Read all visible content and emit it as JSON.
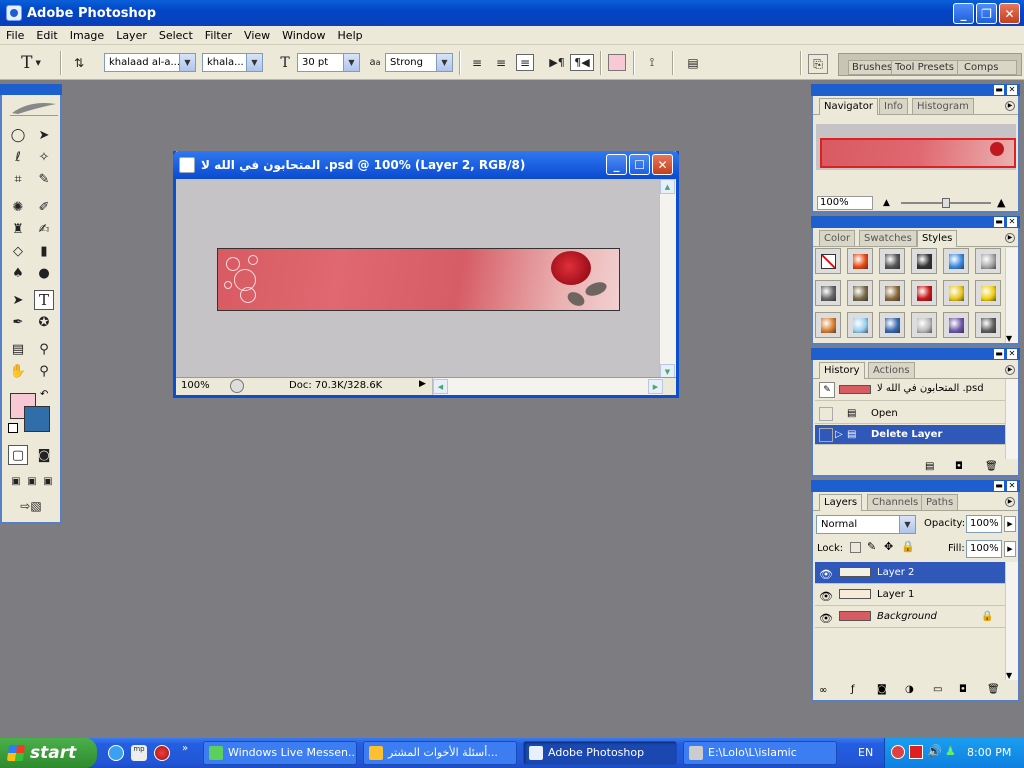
{
  "app": {
    "title": "Adobe Photoshop"
  },
  "menu": [
    "File",
    "Edit",
    "Image",
    "Layer",
    "Select",
    "Filter",
    "View",
    "Window",
    "Help"
  ],
  "options": {
    "font_family": "khalaad al-a...",
    "font_style": "khala...",
    "font_size": "30 pt",
    "aa_label": "a",
    "antialias": "Strong",
    "text_color": "#f8c8d4"
  },
  "palette_well": {
    "tabs": [
      "Brushes",
      "Tool Presets",
      "Comps"
    ]
  },
  "document": {
    "title": "المتحابون في الله لا .psd @ 100% (Layer 2, RGB/8)",
    "zoom": "100%",
    "doc_info": "Doc: 70.3K/328.6K"
  },
  "colors": {
    "foreground": "#f8c8d4",
    "background": "#2f6ea8",
    "selection": "#2f58b8"
  },
  "navigator": {
    "tabs": [
      "Navigator",
      "Info",
      "Histogram"
    ],
    "zoom": "100%",
    "zoom_percent": 50
  },
  "color_panel": {
    "tabs": [
      "Color",
      "Swatches",
      "Styles"
    ]
  },
  "styles": [
    {
      "icon": "none-style",
      "color": "#ffffff"
    },
    {
      "icon": "fire-style",
      "color": "#e84a10"
    },
    {
      "icon": "dark-style",
      "color": "#555555"
    },
    {
      "icon": "chrome-style",
      "color": "#333333"
    },
    {
      "icon": "blue-glass-style",
      "color": "#3a8ae0"
    },
    {
      "icon": "gray-style",
      "color": "#a8a8a8"
    },
    {
      "icon": "steel-style",
      "color": "#666666"
    },
    {
      "icon": "bronze-style",
      "color": "#7a6a48"
    },
    {
      "icon": "wood-style",
      "color": "#8a6a3a"
    },
    {
      "icon": "red-style",
      "color": "#c81818"
    },
    {
      "icon": "multicolor-style",
      "color": "#e8c820"
    },
    {
      "icon": "yellow-style",
      "color": "#f0d010"
    },
    {
      "icon": "orange-style",
      "color": "#d88030"
    },
    {
      "icon": "sky-style",
      "color": "#9ad0f0"
    },
    {
      "icon": "sunset-style",
      "color": "#3a6ab0"
    },
    {
      "icon": "gray-pattern-style",
      "color": "#bcbcbc"
    },
    {
      "icon": "purple-style",
      "color": "#7058a8"
    },
    {
      "icon": "charcoal-style",
      "color": "#606060"
    }
  ],
  "history": {
    "tabs": [
      "History",
      "Actions"
    ],
    "snapshot": "المتحابون في الله لا .psd",
    "items": [
      "Open",
      "Delete Layer"
    ]
  },
  "layers": {
    "tabs": [
      "Layers",
      "Channels",
      "Paths"
    ],
    "blend_mode": "Normal",
    "opacity_label": "Opacity:",
    "opacity": "100%",
    "lock_label": "Lock:",
    "fill_label": "Fill:",
    "fill": "100%",
    "items": [
      {
        "name": "Layer 2"
      },
      {
        "name": "Layer 1"
      },
      {
        "name": "Background"
      }
    ]
  },
  "taskbar": {
    "start": "start",
    "tasks": [
      "Windows Live Messen...",
      "أسئلة الأخوات المشتر...",
      "Adobe Photoshop",
      "E:\\Lolo\\L\\islamic"
    ],
    "lang": "EN",
    "time": "8:00 PM"
  }
}
